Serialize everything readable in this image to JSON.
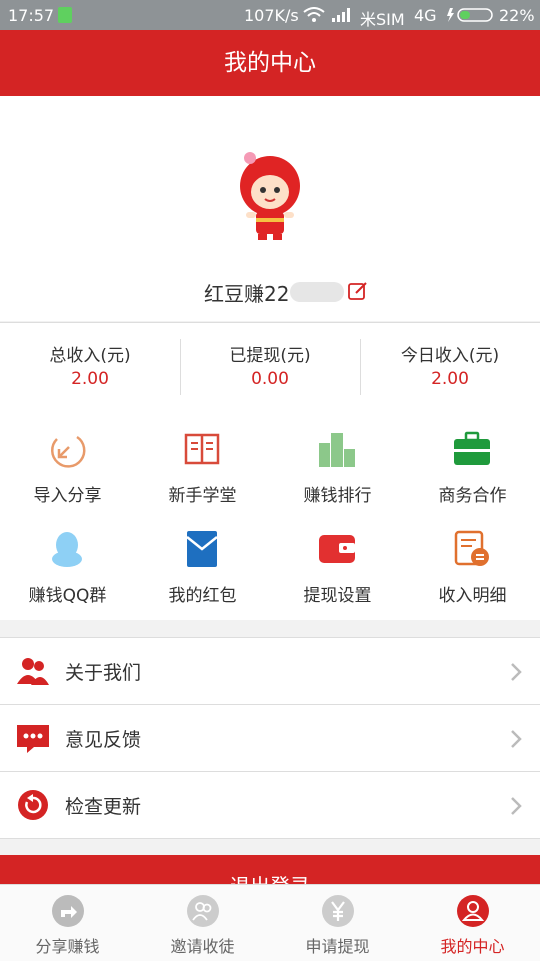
{
  "status_bar": {
    "time": "17:57",
    "net_speed": "107K/s",
    "carrier": "米SIM",
    "network": "4G",
    "battery": "22%"
  },
  "header": {
    "title": "我的中心"
  },
  "profile": {
    "username": "红豆赚22"
  },
  "stats": [
    {
      "label": "总收入(元)",
      "value": "2.00"
    },
    {
      "label": "已提现(元)",
      "value": "0.00"
    },
    {
      "label": "今日收入(元)",
      "value": "2.00"
    }
  ],
  "features": [
    {
      "label": "导入分享",
      "icon": "import-share-icon"
    },
    {
      "label": "新手学堂",
      "icon": "book-icon"
    },
    {
      "label": "赚钱排行",
      "icon": "podium-icon"
    },
    {
      "label": "商务合作",
      "icon": "briefcase-icon"
    },
    {
      "label": "赚钱QQ群",
      "icon": "qq-penguin-icon"
    },
    {
      "label": "我的红包",
      "icon": "red-envelope-icon"
    },
    {
      "label": "提现设置",
      "icon": "wallet-icon"
    },
    {
      "label": "收入明细",
      "icon": "income-detail-icon"
    }
  ],
  "menu": [
    {
      "label": "关于我们",
      "icon": "users-icon"
    },
    {
      "label": "意见反馈",
      "icon": "chat-icon"
    },
    {
      "label": "检查更新",
      "icon": "refresh-icon"
    }
  ],
  "logout_label": "退出登录",
  "tabs": [
    {
      "label": "分享赚钱",
      "icon": "share-icon"
    },
    {
      "label": "邀请收徒",
      "icon": "invite-icon"
    },
    {
      "label": "申请提现",
      "icon": "yuan-icon"
    },
    {
      "label": "我的中心",
      "icon": "profile-icon",
      "active": true
    }
  ],
  "colors": {
    "primary": "#d42424",
    "status_bar": "#8e9396"
  }
}
